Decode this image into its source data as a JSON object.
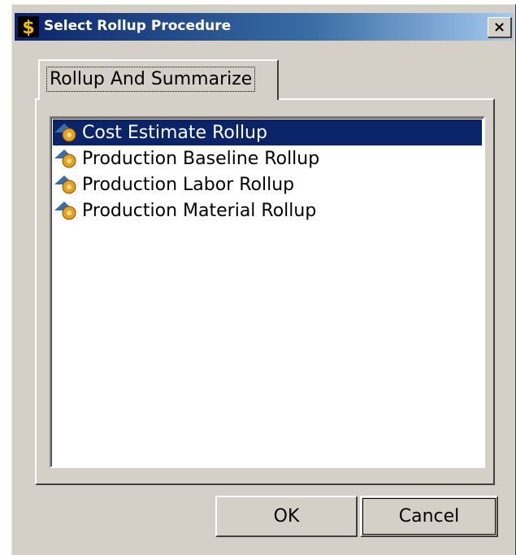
{
  "window": {
    "title": "Select Rollup Procedure",
    "close_label": "×",
    "app_icon": "dollar-icon"
  },
  "tabs": [
    {
      "label": "Rollup And Summarize",
      "selected": true
    }
  ],
  "list": {
    "items": [
      {
        "label": "Cost Estimate Rollup",
        "icon": "rollup-procedure-icon",
        "selected": true
      },
      {
        "label": "Production Baseline Rollup",
        "icon": "rollup-procedure-icon",
        "selected": false
      },
      {
        "label": "Production Labor Rollup",
        "icon": "rollup-procedure-icon",
        "selected": false
      },
      {
        "label": "Production Material Rollup",
        "icon": "rollup-procedure-icon",
        "selected": false
      }
    ]
  },
  "buttons": {
    "ok_label": "OK",
    "cancel_label": "Cancel"
  },
  "colors": {
    "selection": "#0a246a",
    "titlebar_start": "#0a246a",
    "titlebar_end": "#a6caf0",
    "face": "#d4d0c8"
  }
}
